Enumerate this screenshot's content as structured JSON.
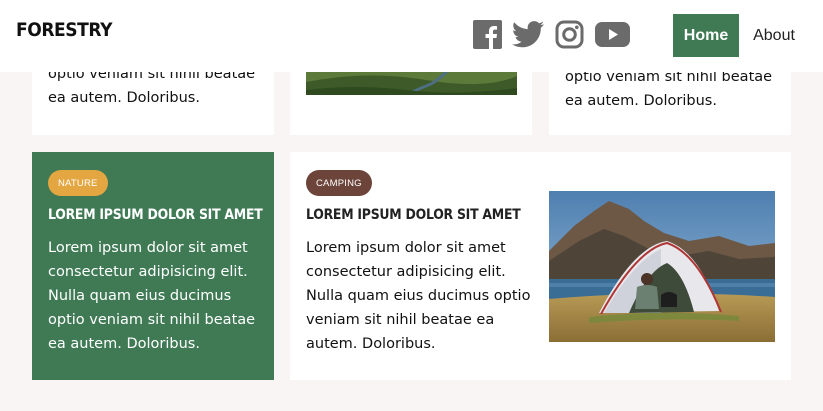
{
  "header": {
    "logo": "FORESTRY",
    "social": [
      "facebook-icon",
      "twitter-icon",
      "instagram-icon",
      "youtube-icon"
    ],
    "nav": {
      "home": "Home",
      "about": "About"
    },
    "colors": {
      "accent": "#3f7a55",
      "social_icon": "#6b6b6b"
    }
  },
  "top_row": {
    "left": {
      "text_line1": "optio veniam sit nihil beatae",
      "text_line2": "ea autem. Doloribus."
    },
    "right": {
      "text_line1": "optio veniam sit nihil beatae",
      "text_line2": "ea autem. Doloribus."
    }
  },
  "cards": [
    {
      "tag": "NATURE",
      "title": "LOREM IPSUM DOLOR SIT AMET",
      "text": "Lorem ipsum dolor sit amet consectetur adipisicing elit. Nulla quam eius ducimus optio veniam sit nihil beatae ea autem. Doloribus.",
      "bg": "#3f7a55",
      "tag_color": "#e3a640"
    },
    {
      "tag": "CAMPING",
      "title": "LOREM IPSUM DOLOR SIT AMET",
      "text": "Lorem ipsum dolor sit amet consectetur adipisicing elit. Nulla quam eius ducimus optio veniam sit nihil beatae ea autem. Doloribus.",
      "tag_color": "#6d443a",
      "image": "camping-tent-photo"
    }
  ]
}
